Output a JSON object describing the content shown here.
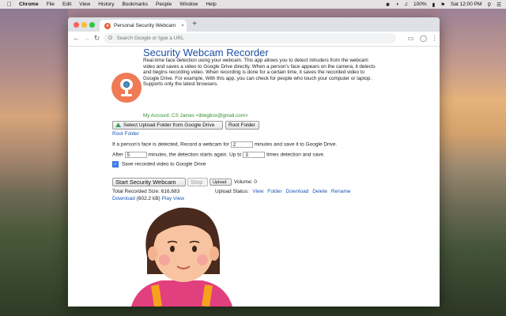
{
  "menubar": {
    "app": "Chrome",
    "items": [
      "File",
      "Edit",
      "View",
      "History",
      "Bookmarks",
      "People",
      "Window",
      "Help"
    ],
    "battery": "100%",
    "clock": "Sat 12:00 PM"
  },
  "tab": {
    "title": "Personal Security Webcam"
  },
  "omnibox": {
    "placeholder": "Search Google or type a URL"
  },
  "app": {
    "title": "Security Webcam Recorder",
    "description": "Real-time face detection using your webcam. This app allows you to detect intruders from the webcam video and saves a video to Google Drive directly. When a person's face appears on the camera, it detects and begins recording video. When recording is done for a certain time, it saves the recorded video to Google Drive. For example, With this app, you can check for people who touch your computer or laptop. Supports only the latest browsers.",
    "account": "My Account: CS James <iblegbox@gmail.com>",
    "select_folder_label": "Select Upload Folder from Google Drive",
    "root_folder_button": "Root Folder",
    "root_folder_link": "Root Folder",
    "record_prefix": "If a person's face is detected, Record a webcam for",
    "record_value": "2",
    "record_suffix": "minutes and save it to Google Drive.",
    "after_prefix": "After",
    "after_value": "5",
    "after_mid": "minutes, the detection starts again. Up to",
    "upto_value": "3",
    "after_suffix": "times detection and save.",
    "save_checkbox_label": "Save recorded video to Google Drive",
    "start_label": "Start Security Webcam",
    "stop_label": "Stop",
    "upload_label": "Upload",
    "volume_label": "Volume: 0",
    "total_label": "Total Recorded Size: 616,683",
    "upload_status_label": "Upload Status:",
    "status_links": [
      "View",
      "Folder",
      "Download",
      "Delete",
      "Rename"
    ],
    "download_label": "Download",
    "download_size": "(602.2 kB)",
    "play_label": "Play",
    "view_label": "View"
  }
}
